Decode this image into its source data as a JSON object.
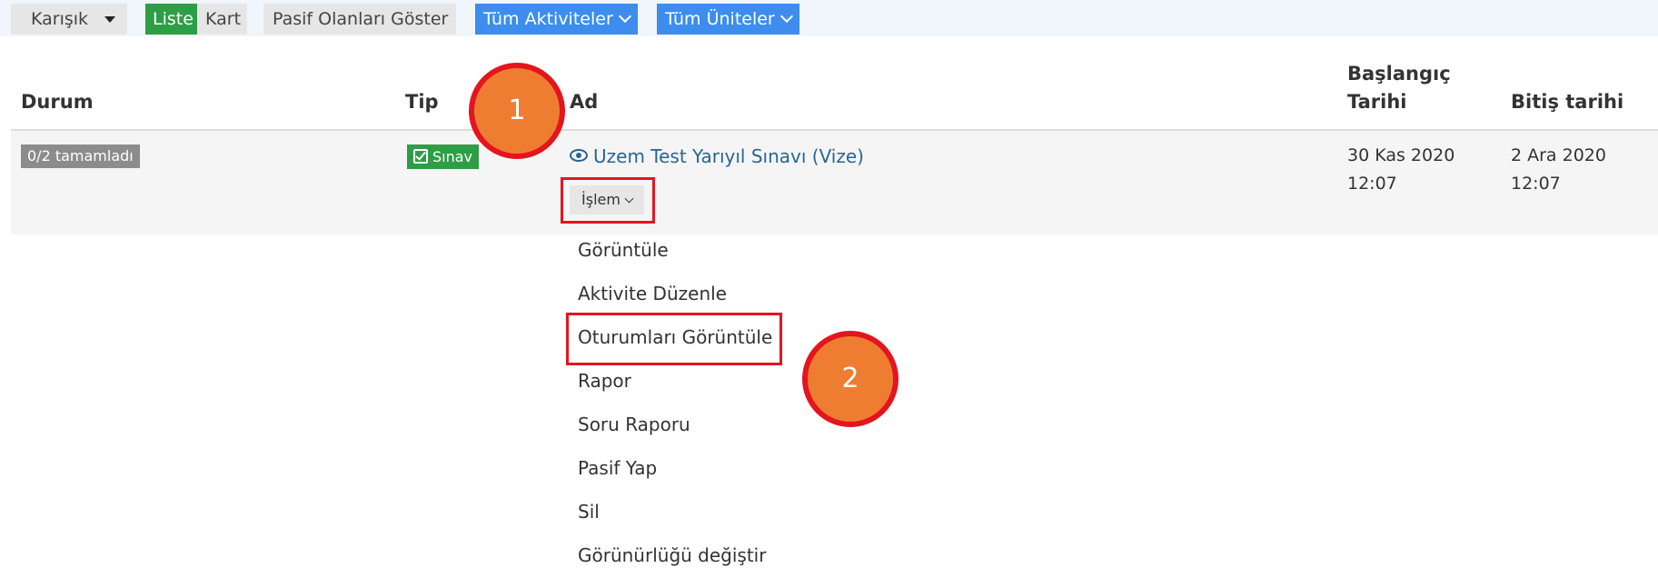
{
  "toolbar": {
    "mode_label": "Karışık",
    "view_list": "Liste",
    "view_card": "Kart",
    "show_passive": "Pasif Olanları Göster",
    "all_activities": "Tüm Aktiviteler",
    "all_units": "Tüm Üniteler"
  },
  "table": {
    "headers": {
      "status": "Durum",
      "type": "Tip",
      "name": "Ad",
      "start_line1": "Başlangıç",
      "start_line2": "Tarihi",
      "end": "Bitiş tarihi"
    },
    "row": {
      "status": "0/2 tamamladı",
      "type": "Sınav",
      "name": "Uzem Test Yarıyıl Sınavı (Vize)",
      "action_button": "İşlem",
      "start_date": "30 Kas 2020",
      "start_time": "12:07",
      "end_date": "2 Ara 2020",
      "end_time": "12:07"
    }
  },
  "menu": {
    "items": [
      "Görüntüle",
      "Aktivite Düzenle",
      "Oturumları Görüntüle",
      "Rapor",
      "Soru Raporu",
      "Pasif Yap",
      "Sil",
      "Görünürlüğü değiştir"
    ]
  },
  "annotations": {
    "step1": "1",
    "step2": "2"
  },
  "colors": {
    "green": "#2e9e46",
    "blue": "#3c8dee",
    "link": "#2a6496",
    "highlight_red": "#e4151e",
    "marker_orange": "#ee7d32"
  }
}
